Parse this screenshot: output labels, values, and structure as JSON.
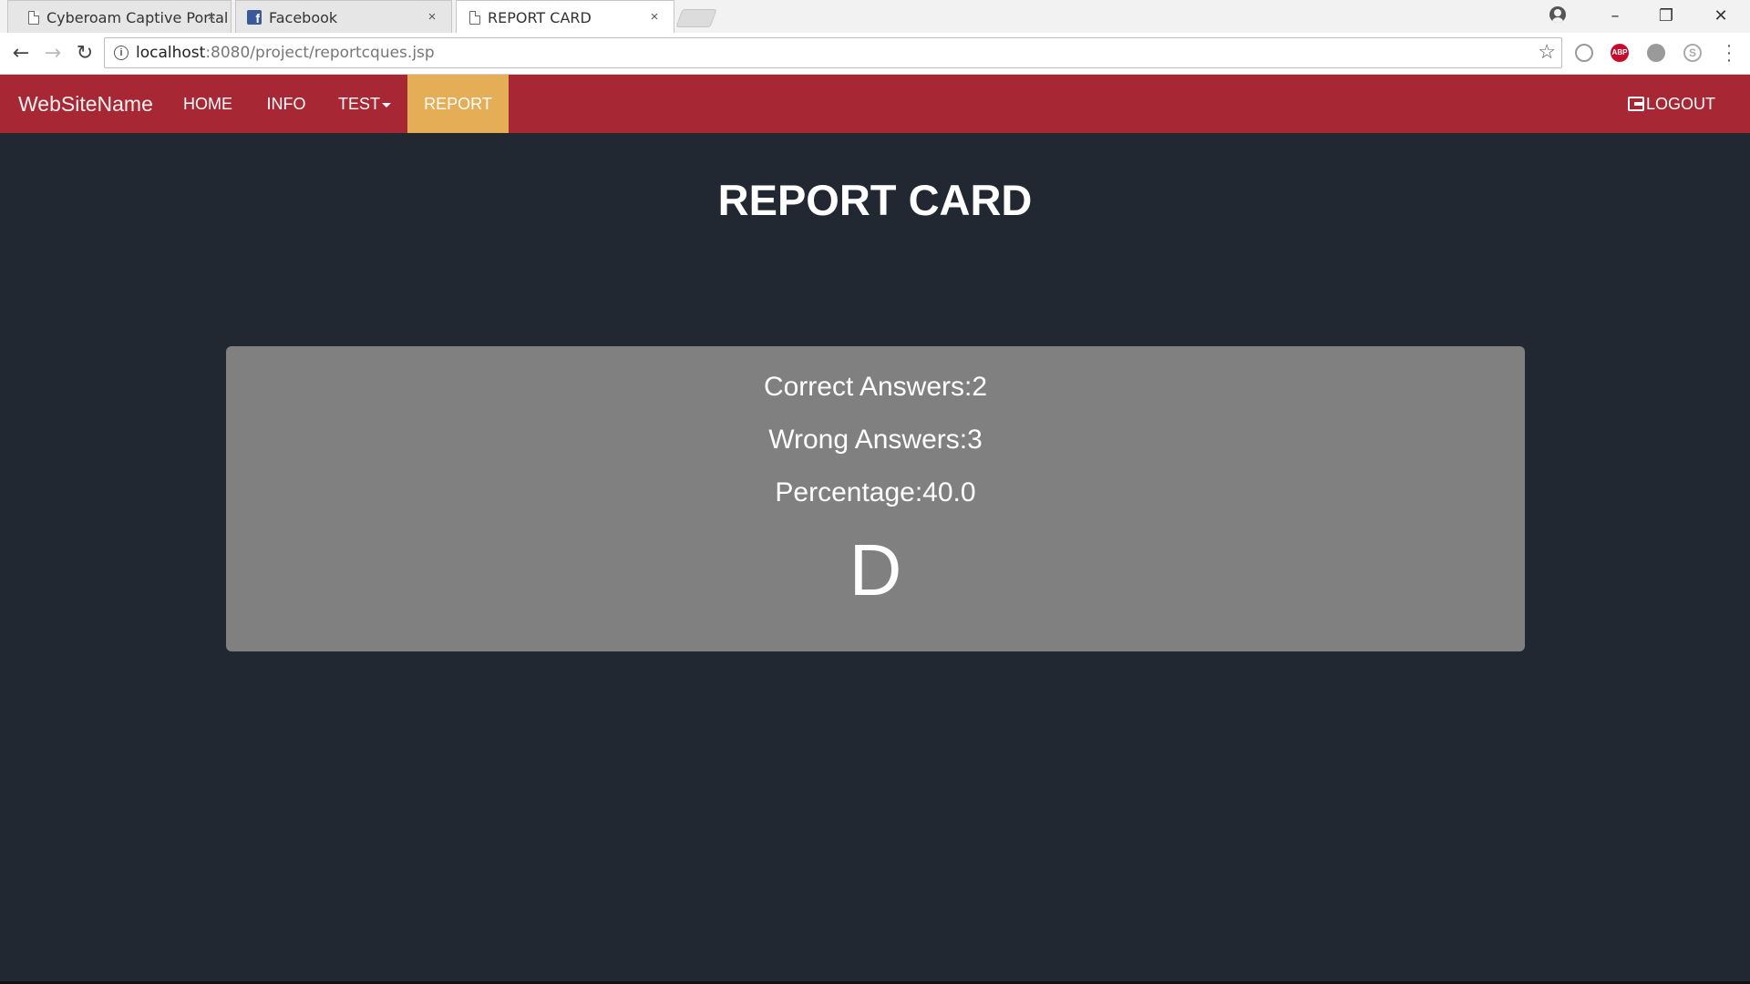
{
  "browser": {
    "tabs": [
      {
        "title": "Cyberoam Captive Portal",
        "icon": "page-icon"
      },
      {
        "title": "Facebook",
        "icon": "facebook-icon"
      },
      {
        "title": "REPORT CARD",
        "icon": "page-icon",
        "active": true
      }
    ],
    "close_glyph": "×",
    "url_host": "localhost",
    "url_rest": ":8080/project/reportcques.jsp",
    "window_controls": {
      "minimize": "–",
      "restore": "❐",
      "close": "✕"
    },
    "extensions": {
      "abp_label": "ABP",
      "skype_label": "S"
    }
  },
  "site": {
    "brand": "WebSiteName",
    "nav": {
      "home": "HOME",
      "info": "INFO",
      "test": "TEST",
      "report": "REPORT",
      "logout": "LOGOUT"
    },
    "colors": {
      "navbar": "#a82734",
      "active_tab": "#e5ad56",
      "background": "#222831",
      "card": "#808080"
    }
  },
  "report": {
    "title": "REPORT CARD",
    "correct": "Correct Answers:2",
    "wrong": "Wrong Answers:3",
    "percentage": "Percentage:40.0",
    "grade": "D"
  }
}
